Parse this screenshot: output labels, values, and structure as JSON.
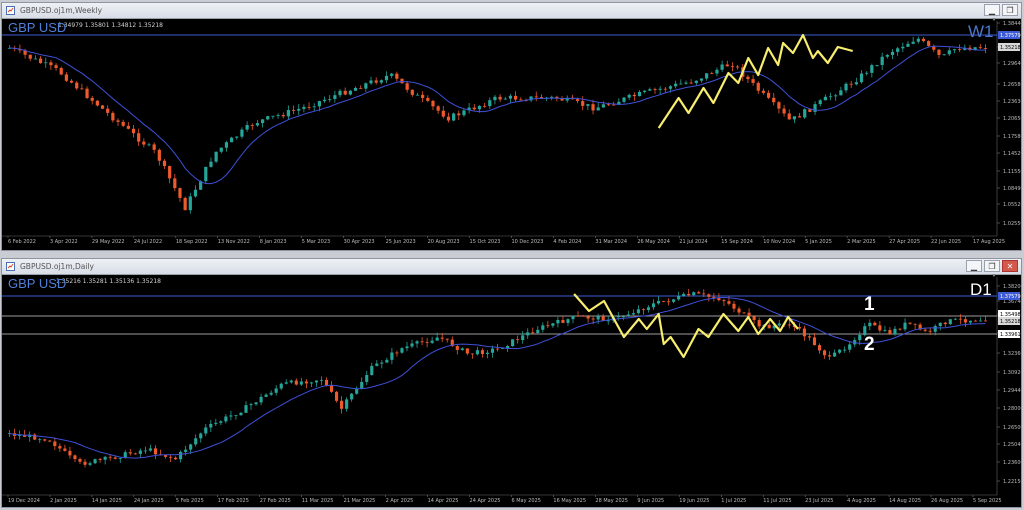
{
  "weekly": {
    "window_title": "GBPUSD.oj1m,Weekly",
    "ohlc": "1.34979 1.35801 1.34812 1.35218",
    "symbol_label": "GBP USD",
    "timeframe_label": "W1",
    "price_ticks": [
      "1.38440",
      "1.32555",
      "1.29640",
      "1.26580",
      "1.23630",
      "1.20650",
      "1.17580",
      "1.14520",
      "1.11550",
      "1.08490",
      "1.05520",
      "1.02550"
    ],
    "current_price": "1.35218",
    "level_price": "1.37579",
    "date_ticks": [
      "6 Feb 2022",
      "3 Apr 2022",
      "29 May 2022",
      "24 Jul 2022",
      "18 Sep 2022",
      "13 Nov 2022",
      "8 Jan 2023",
      "5 Mar 2023",
      "30 Apr 2023",
      "25 Jun 2023",
      "20 Aug 2023",
      "15 Oct 2023",
      "10 Dec 2023",
      "4 Feb 2024",
      "31 Mar 2024",
      "26 May 2024",
      "21 Jul 2024",
      "15 Sep 2024",
      "10 Nov 2024",
      "5 Jan 2025",
      "2 Mar 2025",
      "27 Apr 2025",
      "22 Jun 2025",
      "17 Aug 2025"
    ]
  },
  "daily": {
    "window_title": "GBPUSD.oj1m,Daily",
    "ohlc": "1.35216 1.35281 1.35136 1.35218",
    "symbol_label": "GBP USD",
    "timeframe_label": "D1",
    "level_1_label": "1",
    "level_2_label": "2",
    "price_ticks": [
      "1.38200",
      "1.36740",
      "1.35498",
      "1.33961",
      "1.32360",
      "1.30920",
      "1.29440",
      "1.28000",
      "1.26500",
      "1.25040",
      "1.23600",
      "1.22150"
    ],
    "level_1_price": "1.35498",
    "level_2_price": "1.33961",
    "current_price": "1.35218",
    "level_price": "1.37579",
    "date_ticks": [
      "19 Dec 2024",
      "2 Jan 2025",
      "14 Jan 2025",
      "24 Jan 2025",
      "5 Feb 2025",
      "17 Feb 2025",
      "27 Feb 2025",
      "11 Mar 2025",
      "21 Mar 2025",
      "2 Apr 2025",
      "14 Apr 2025",
      "24 Apr 2025",
      "6 May 2025",
      "16 May 2025",
      "28 May 2025",
      "9 Jun 2025",
      "19 Jun 2025",
      "1 Jul 2025",
      "11 Jul 2025",
      "23 Jul 2025",
      "4 Aug 2025",
      "14 Aug 2025",
      "26 Aug 2025",
      "5 Sep 2025"
    ]
  },
  "colors": {
    "bull": "#26a69a",
    "bear": "#ef5a2c",
    "ma": "#3f51d8",
    "zigzag": "#f7ee6e",
    "level_line": "#3d5bd6",
    "hline": "#cfcfcf"
  }
}
